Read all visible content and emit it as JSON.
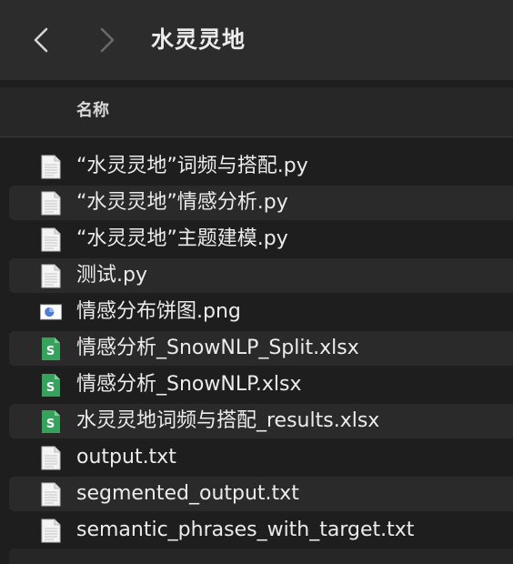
{
  "window": {
    "title": "水灵灵地",
    "back_icon": "chevron-left-icon",
    "forward_icon": "chevron-right-icon"
  },
  "list_header": {
    "name": "名称"
  },
  "files": [
    {
      "name": "“水灵灵地”词频与搭配.py",
      "icon": "python-file-icon"
    },
    {
      "name": "“水灵灵地”情感分析.py",
      "icon": "python-file-icon"
    },
    {
      "name": "“水灵灵地”主题建模.py",
      "icon": "python-file-icon"
    },
    {
      "name": "测试.py",
      "icon": "python-file-icon"
    },
    {
      "name": "情感分布饼图.png",
      "icon": "image-file-icon"
    },
    {
      "name": "情感分析_SnowNLP_Split.xlsx",
      "icon": "spreadsheet-file-icon"
    },
    {
      "name": "情感分析_SnowNLP.xlsx",
      "icon": "spreadsheet-file-icon"
    },
    {
      "name": "水灵灵地词频与搭配_results.xlsx",
      "icon": "spreadsheet-file-icon"
    },
    {
      "name": "output.txt",
      "icon": "text-file-icon"
    },
    {
      "name": "segmented_output.txt",
      "icon": "text-file-icon"
    },
    {
      "name": "semantic_phrases_with_target.txt",
      "icon": "text-file-icon"
    }
  ],
  "colors": {
    "background": "#1e1e1e",
    "toolbar": "#2c2c2c",
    "row_alternate": "#2a2a2a",
    "spreadsheet_green": "#35a35b"
  }
}
